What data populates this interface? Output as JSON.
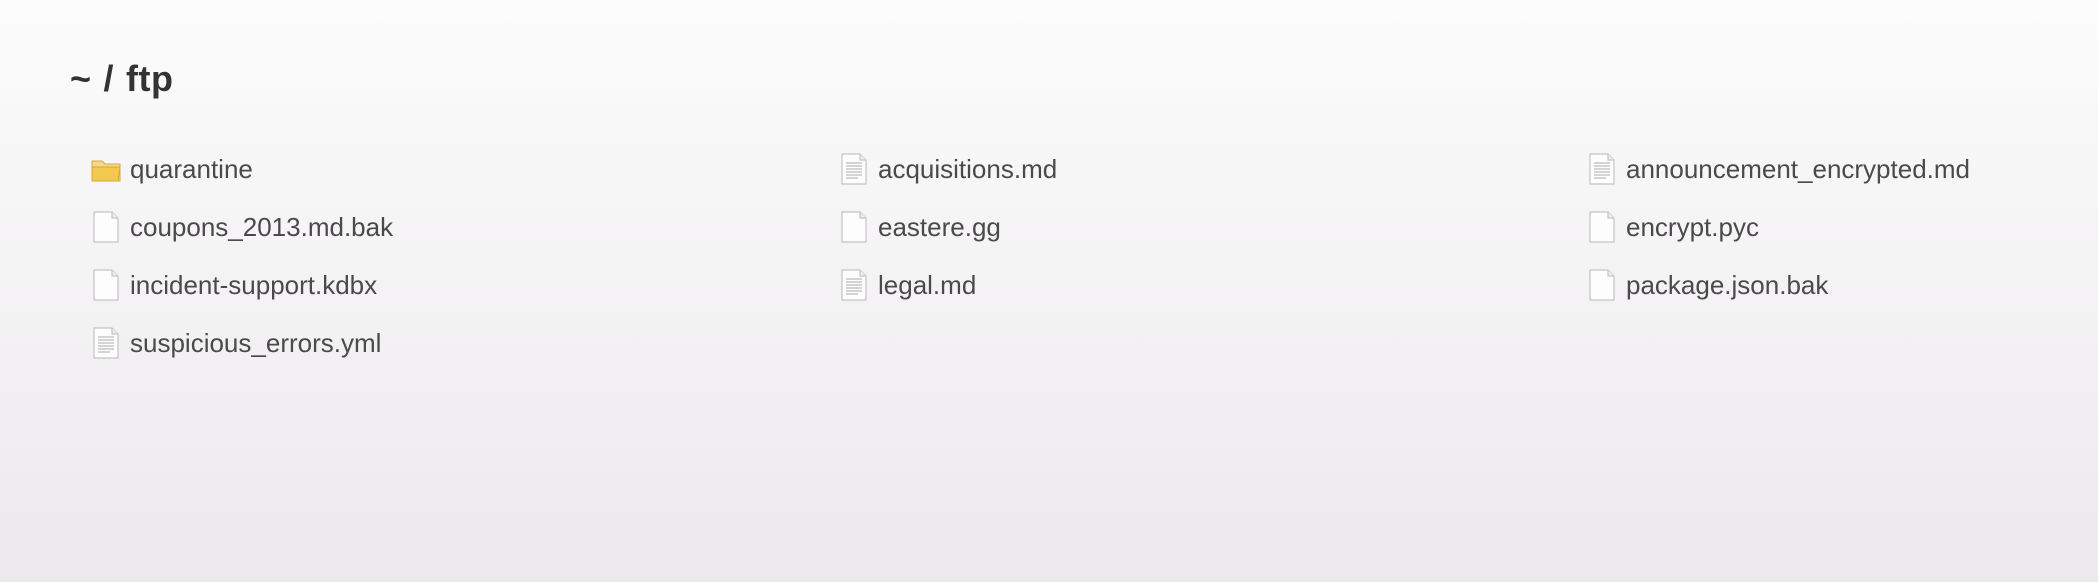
{
  "breadcrumb": {
    "home": "~",
    "separator": "/",
    "current": "ftp"
  },
  "files": [
    {
      "name": "quarantine",
      "type": "folder",
      "icon": "folder-icon"
    },
    {
      "name": "acquisitions.md",
      "type": "text",
      "icon": "text-file-icon"
    },
    {
      "name": "announcement_encrypted.md",
      "type": "text",
      "icon": "text-file-icon"
    },
    {
      "name": "coupons_2013.md.bak",
      "type": "file",
      "icon": "file-icon"
    },
    {
      "name": "eastere.gg",
      "type": "file",
      "icon": "file-icon"
    },
    {
      "name": "encrypt.pyc",
      "type": "file",
      "icon": "file-icon"
    },
    {
      "name": "incident-support.kdbx",
      "type": "file",
      "icon": "file-icon"
    },
    {
      "name": "legal.md",
      "type": "text",
      "icon": "text-file-icon"
    },
    {
      "name": "package.json.bak",
      "type": "file",
      "icon": "file-icon"
    },
    {
      "name": "suspicious_errors.yml",
      "type": "text",
      "icon": "text-file-icon"
    }
  ],
  "colors": {
    "text": "#4a4a4a",
    "heading": "#333333",
    "folder": "#f2c94c",
    "file_outline": "#c4c4c4"
  }
}
